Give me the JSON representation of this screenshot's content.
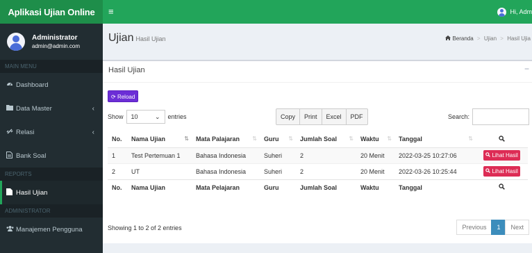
{
  "app": {
    "title": "Aplikasi Ujian Online",
    "menu_icon": "≡",
    "user_greeting": "Hi, Adm"
  },
  "sidebar": {
    "user": {
      "name": "Administrator",
      "email": "admin@admin.com"
    },
    "sections": [
      {
        "header": "MAIN MENU",
        "items": [
          {
            "label": "Dashboard",
            "icon": "dashboard-icon"
          },
          {
            "label": "Data Master",
            "icon": "folder-icon",
            "has_children": true
          },
          {
            "label": "Relasi",
            "icon": "link-icon",
            "has_children": true
          },
          {
            "label": "Bank Soal",
            "icon": "file-icon"
          }
        ]
      },
      {
        "header": "REPORTS",
        "items": [
          {
            "label": "Hasil Ujian",
            "icon": "file-icon",
            "active": true
          }
        ]
      },
      {
        "header": "ADMINISTRATOR",
        "items": [
          {
            "label": "Manajemen Pengguna",
            "icon": "users-icon"
          }
        ]
      }
    ]
  },
  "page": {
    "title": "Ujian",
    "subtitle": "Hasil Ujian",
    "breadcrumb": [
      "Beranda",
      "Ujian",
      "Hasil Ujia"
    ]
  },
  "box": {
    "title": "Hasil Ujian",
    "collapse": "−",
    "reload_label": "Reload",
    "show_label": "Show",
    "entries_value": "10",
    "entries_label": "entries",
    "export_buttons": [
      "Copy",
      "Print",
      "Excel",
      "PDF"
    ],
    "search_label": "Search:",
    "search_value": "",
    "table": {
      "headers": [
        "No.",
        "Nama Ujian",
        "Mata Palajaran",
        "Guru",
        "Jumlah Soal",
        "Waktu",
        "Tanggal",
        "Q"
      ],
      "footers": [
        "No.",
        "Nama Ujian",
        "Mata Pelajaran",
        "Guru",
        "Jumlah Soal",
        "Waktu",
        "Tanggal",
        "Q"
      ],
      "rows": [
        {
          "no": "1",
          "nama": "Test Pertemuan 1",
          "mapel": "Bahasa Indonesia",
          "guru": "Suheri",
          "jumlah": "2",
          "waktu": "20 Menit",
          "tanggal": "2022-03-25 10:27:06",
          "action": "Lihat Hasil"
        },
        {
          "no": "2",
          "nama": "UT",
          "mapel": "Bahasa Indonesia",
          "guru": "Suheri",
          "jumlah": "2",
          "waktu": "20 Menit",
          "tanggal": "2022-03-26 10:25:44",
          "action": "Lihat Hasil"
        }
      ]
    },
    "info": "Showing 1 to 2 of 2 entries",
    "pagination": {
      "previous": "Previous",
      "current": "1",
      "next": "Next"
    }
  },
  "colors": {
    "header_green": "#22a55a",
    "logo_green": "#1e8e4a",
    "sidebar_bg": "#222d32",
    "reload_purple": "#6c2ed6",
    "lihat_red": "#dd2c55",
    "page_blue": "#3c8dbc"
  }
}
